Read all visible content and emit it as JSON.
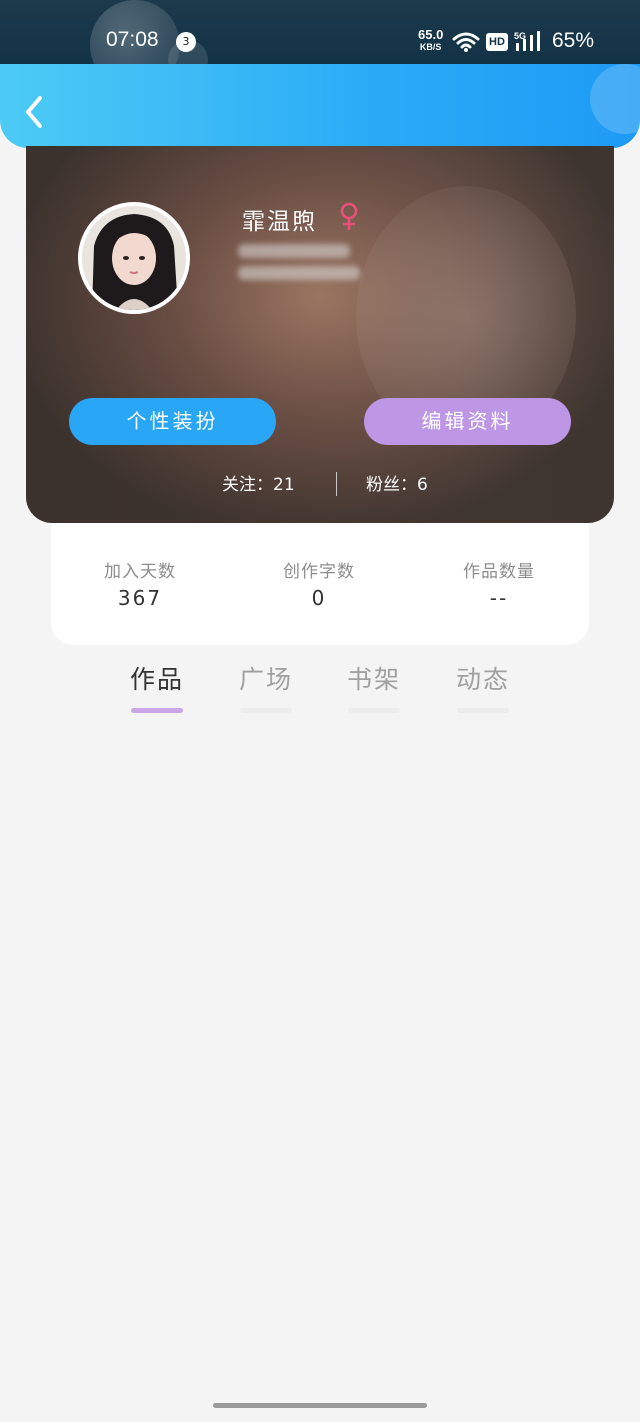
{
  "status_bar": {
    "time": "07:08",
    "notification_count": "3",
    "net_speed": "65.0",
    "net_speed_unit": "KB/S",
    "hd_label": "HD",
    "network_type": "5G",
    "battery": "65%"
  },
  "header": {
    "back_icon": "chevron-left-icon"
  },
  "profile": {
    "nickname": "霏温煦",
    "gender_icon": "female-icon",
    "gender_color": "#e8527a",
    "dress_button": "个性装扮",
    "edit_button": "编辑资料",
    "following": "关注：21",
    "fans": "粉丝：6"
  },
  "stats": [
    {
      "label": "加入天数",
      "value": "367"
    },
    {
      "label": "创作字数",
      "value": "0"
    },
    {
      "label": "作品数量",
      "value": "--"
    }
  ],
  "tabs": [
    {
      "label": "作品",
      "active": true
    },
    {
      "label": "广场",
      "active": false
    },
    {
      "label": "书架",
      "active": false
    },
    {
      "label": "动态",
      "active": false
    }
  ],
  "colors": {
    "header_start": "#4dcbf5",
    "header_end": "#1e9af5",
    "dress_button": "#29a6f6",
    "edit_button": "#be96e6",
    "tab_active_underline": "#c9a6e6"
  }
}
